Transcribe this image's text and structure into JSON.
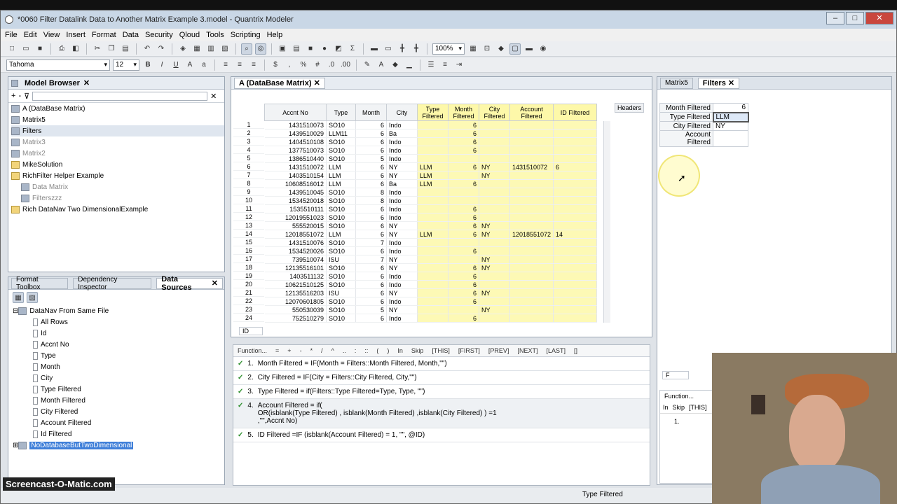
{
  "window": {
    "title": "*0060 Filter Datalink Data to Another Matrix Example 3.model - Quantrix Modeler"
  },
  "menu": [
    "File",
    "Edit",
    "View",
    "Insert",
    "Format",
    "Data",
    "Security",
    "Qloud",
    "Tools",
    "Scripting",
    "Help"
  ],
  "toolbar": {
    "zoom": "100%",
    "font": "Tahoma",
    "font_size": "12"
  },
  "model_browser": {
    "title": "Model Browser",
    "items": [
      {
        "label": "A (DataBase Matrix)",
        "kind": "cube"
      },
      {
        "label": "Matrix5",
        "kind": "cube"
      },
      {
        "label": "Filters",
        "kind": "cube",
        "selected": true
      },
      {
        "label": "Matrix3",
        "kind": "cube",
        "dim": true
      },
      {
        "label": "Matrix2",
        "kind": "cube",
        "dim": true
      },
      {
        "label": "MikeSolution",
        "kind": "folder"
      },
      {
        "label": "RichFilter Helper Example",
        "kind": "folder"
      },
      {
        "label": "Data Matrix",
        "kind": "cube",
        "dim": true,
        "indent": 1
      },
      {
        "label": "Filterszzz",
        "kind": "cube",
        "dim": true,
        "indent": 1
      },
      {
        "label": "Rich DataNav Two DimensionalExample",
        "kind": "folder"
      }
    ]
  },
  "bottom_tabs": {
    "format": "Format Toolbox",
    "dependency": "Dependency Inspector",
    "datasources": "Data Sources"
  },
  "datasources": {
    "root": "DataNav From Same File",
    "fields": [
      "All Rows",
      "Id",
      "Accnt No",
      "Type",
      "Month",
      "City",
      "Type Filtered",
      "Month Filtered",
      "City Filtered",
      "Account Filtered",
      "Id Filtered"
    ],
    "selected": "NoDatabaseButTwoDimensional"
  },
  "matrix": {
    "tab": "A (DataBase Matrix)",
    "headers_btn": "Headers",
    "columns": [
      "Accnt No",
      "Type",
      "Month",
      "City",
      "Type Filtered",
      "Month Filtered",
      "City Filtered",
      "Account Filtered",
      "ID Filtered"
    ],
    "rows": [
      [
        "1",
        "1431510073",
        "SO10",
        "6",
        "Indo",
        "",
        "6",
        "",
        "",
        ""
      ],
      [
        "2",
        "1439510029",
        "LLM11",
        "6",
        "Ba",
        "",
        "6",
        "",
        "",
        ""
      ],
      [
        "3",
        "1404510108",
        "SO10",
        "6",
        "Indo",
        "",
        "6",
        "",
        "",
        ""
      ],
      [
        "4",
        "1377510073",
        "SO10",
        "6",
        "Indo",
        "",
        "6",
        "",
        "",
        ""
      ],
      [
        "5",
        "1386510440",
        "SO10",
        "5",
        "Indo",
        "",
        "",
        "",
        "",
        ""
      ],
      [
        "6",
        "1431510072",
        "LLM",
        "6",
        "NY",
        "LLM",
        "6",
        "NY",
        "1431510072",
        "6"
      ],
      [
        "7",
        "1403510154",
        "LLM",
        "6",
        "NY",
        "LLM",
        "",
        "NY",
        "",
        ""
      ],
      [
        "8",
        "10608516012",
        "LLM",
        "6",
        "Ba",
        "LLM",
        "6",
        "",
        "",
        ""
      ],
      [
        "9",
        "1439510045",
        "SO10",
        "8",
        "Indo",
        "",
        "",
        "",
        "",
        ""
      ],
      [
        "10",
        "1534520018",
        "SO10",
        "8",
        "Indo",
        "",
        "",
        "",
        "",
        ""
      ],
      [
        "11",
        "1535510111",
        "SO10",
        "6",
        "Indo",
        "",
        "6",
        "",
        "",
        ""
      ],
      [
        "12",
        "12019551023",
        "SO10",
        "6",
        "Indo",
        "",
        "6",
        "",
        "",
        ""
      ],
      [
        "13",
        "555520015",
        "SO10",
        "6",
        "NY",
        "",
        "6",
        "NY",
        "",
        ""
      ],
      [
        "14",
        "12018551072",
        "LLM",
        "6",
        "NY",
        "LLM",
        "6",
        "NY",
        "12018551072",
        "14"
      ],
      [
        "15",
        "1431510076",
        "SO10",
        "7",
        "Indo",
        "",
        "",
        "",
        "",
        ""
      ],
      [
        "16",
        "1534520026",
        "SO10",
        "6",
        "Indo",
        "",
        "6",
        "",
        "",
        ""
      ],
      [
        "17",
        "739510074",
        "ISU",
        "7",
        "NY",
        "",
        "",
        "NY",
        "",
        ""
      ],
      [
        "18",
        "12135516101",
        "SO10",
        "6",
        "NY",
        "",
        "6",
        "NY",
        "",
        ""
      ],
      [
        "19",
        "1403511132",
        "SO10",
        "6",
        "Indo",
        "",
        "6",
        "",
        "",
        ""
      ],
      [
        "20",
        "10621510125",
        "SO10",
        "6",
        "Indo",
        "",
        "6",
        "",
        "",
        ""
      ],
      [
        "21",
        "12135516203",
        "ISU",
        "6",
        "NY",
        "",
        "6",
        "NY",
        "",
        ""
      ],
      [
        "22",
        "12070601805",
        "SO10",
        "6",
        "Indo",
        "",
        "6",
        "",
        "",
        ""
      ],
      [
        "23",
        "550530039",
        "SO10",
        "5",
        "NY",
        "",
        "",
        "NY",
        "",
        ""
      ],
      [
        "24",
        "752510279",
        "SO10",
        "6",
        "Indo",
        "",
        "6",
        "",
        "",
        ""
      ]
    ],
    "footer_tab": "ID"
  },
  "formula_toolbar": [
    "Function...",
    "=",
    "+",
    "-",
    "*",
    "/",
    "^",
    "..",
    ":",
    "::",
    "(",
    ")",
    "In",
    "Skip",
    "[THIS]",
    "[FIRST]",
    "[PREV]",
    "[NEXT]",
    "[LAST]",
    "[]"
  ],
  "formulas": [
    {
      "n": "1.",
      "text": "Month Filtered = IF(Month = Filters::Month Filtered, Month,\"\")"
    },
    {
      "n": "2.",
      "text": "City Filtered = IF(City = Filters::City Filtered, City,\"\")"
    },
    {
      "n": "3.",
      "text": "Type Filtered = if(Filters::Type Filtered=Type, Type, \"\")"
    },
    {
      "n": "4.",
      "text": "Account Filtered = if(",
      "text2": "OR(isblank(Type Filtered) , isblank(Month Filtered) ,isblank(City Filtered) ) =1",
      "text3": ",\"\",Accnt No)"
    },
    {
      "n": "5.",
      "text": "ID Filtered =IF (isblank(Account Filtered) = 1, \"\", @ID)"
    }
  ],
  "right_panel": {
    "tabs": [
      "Matrix5",
      "Filters"
    ],
    "filters": [
      [
        "Month Filtered",
        "6"
      ],
      [
        "Type Filtered",
        "LLM"
      ],
      [
        "City Filtered",
        "NY"
      ],
      [
        "Account Filtered",
        ""
      ]
    ],
    "footer_tab": "F",
    "func_label": "Function...",
    "func_tools": [
      "In",
      "Skip",
      "[THIS]"
    ],
    "func_row": "1."
  },
  "status": {
    "text": "Type Filtered"
  },
  "watermark": "Screencast-O-Matic.com"
}
